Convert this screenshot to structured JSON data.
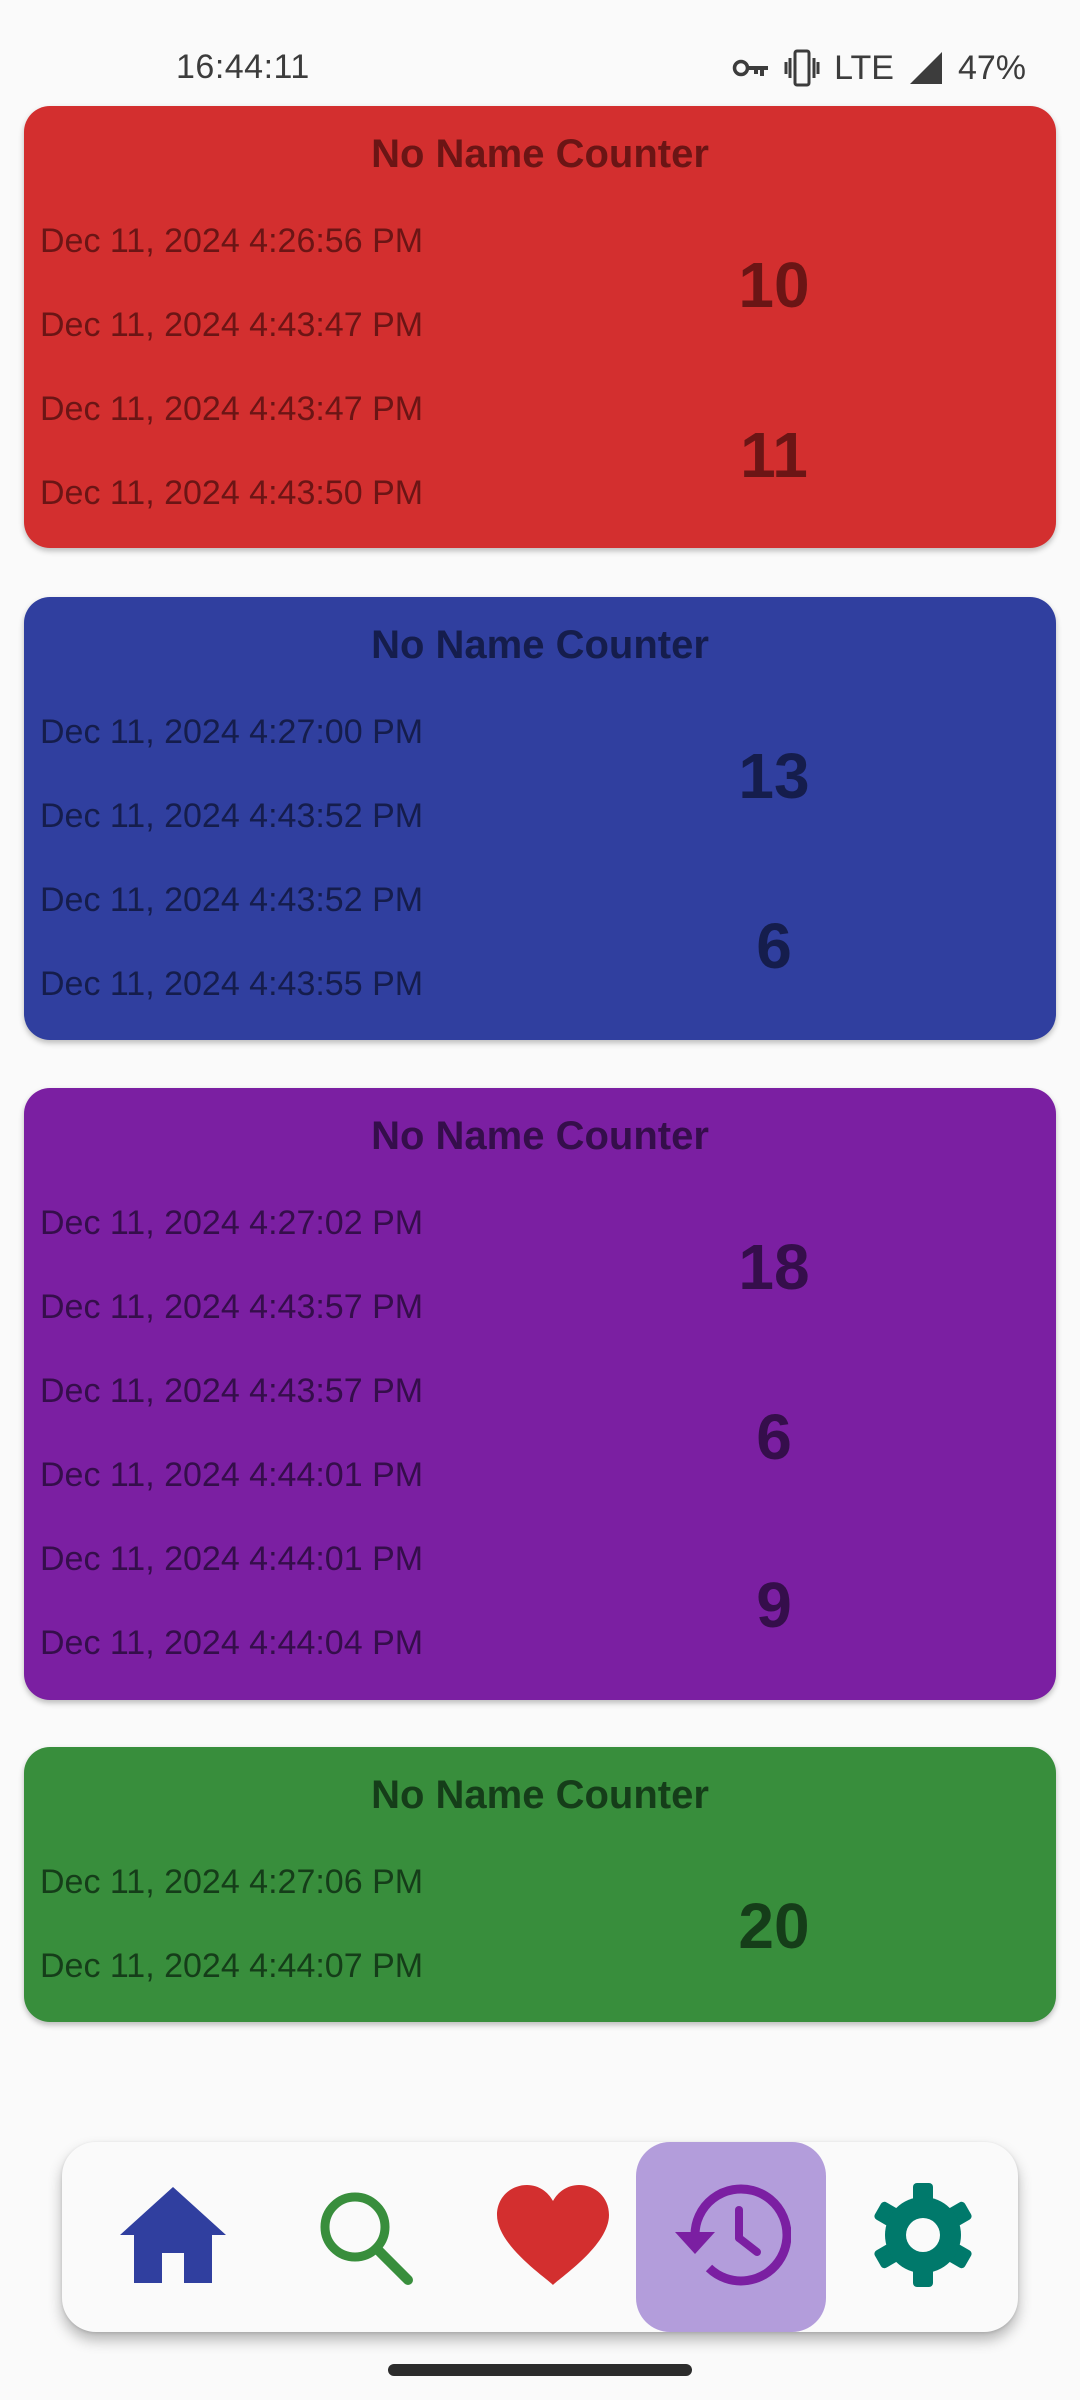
{
  "status": {
    "time": "16:44:11",
    "network": "LTE",
    "battery": "47%",
    "icons": [
      "vpn-key-icon",
      "vibrate-icon",
      "signal-icon"
    ]
  },
  "cards": [
    {
      "title": "No Name Counter",
      "color": "#d32f2f",
      "text_color": "#6b1515",
      "dates": [
        "Dec 11, 2024 4:26:56 PM",
        "Dec 11, 2024 4:43:47 PM",
        "Dec 11, 2024 4:43:47 PM",
        "Dec 11, 2024 4:43:50 PM"
      ],
      "counts": [
        "10",
        "11"
      ]
    },
    {
      "title": "No Name Counter",
      "color": "#303f9f",
      "text_color": "#151d4c",
      "dates": [
        "Dec 11, 2024 4:27:00 PM",
        "Dec 11, 2024 4:43:52 PM",
        "Dec 11, 2024 4:43:52 PM",
        "Dec 11, 2024 4:43:55 PM"
      ],
      "counts": [
        "13",
        "6"
      ]
    },
    {
      "title": "No Name Counter",
      "color": "#7b1fa2",
      "text_color": "#350e4b",
      "dates": [
        "Dec 11, 2024 4:27:02 PM",
        "Dec 11, 2024 4:43:57 PM",
        "Dec 11, 2024 4:43:57 PM",
        "Dec 11, 2024 4:44:01 PM",
        "Dec 11, 2024 4:44:01 PM",
        "Dec 11, 2024 4:44:04 PM"
      ],
      "counts": [
        "18",
        "6",
        "9"
      ]
    },
    {
      "title": "No Name Counter",
      "color": "#388e3c",
      "text_color": "#153d19",
      "dates": [
        "Dec 11, 2024 4:27:06 PM",
        "Dec 11, 2024 4:44:07 PM"
      ],
      "counts": [
        "20"
      ]
    }
  ],
  "nav": {
    "items": [
      {
        "icon": "home-icon",
        "color": "#303f9f",
        "active": false
      },
      {
        "icon": "search-icon",
        "color": "#388e3c",
        "active": false
      },
      {
        "icon": "heart-icon",
        "color": "#d32f2f",
        "active": false
      },
      {
        "icon": "history-icon",
        "color": "#7b1fa2",
        "active": true
      },
      {
        "icon": "settings-icon",
        "color": "#00796b",
        "active": false
      }
    ],
    "active_background": "#b39ddb"
  }
}
